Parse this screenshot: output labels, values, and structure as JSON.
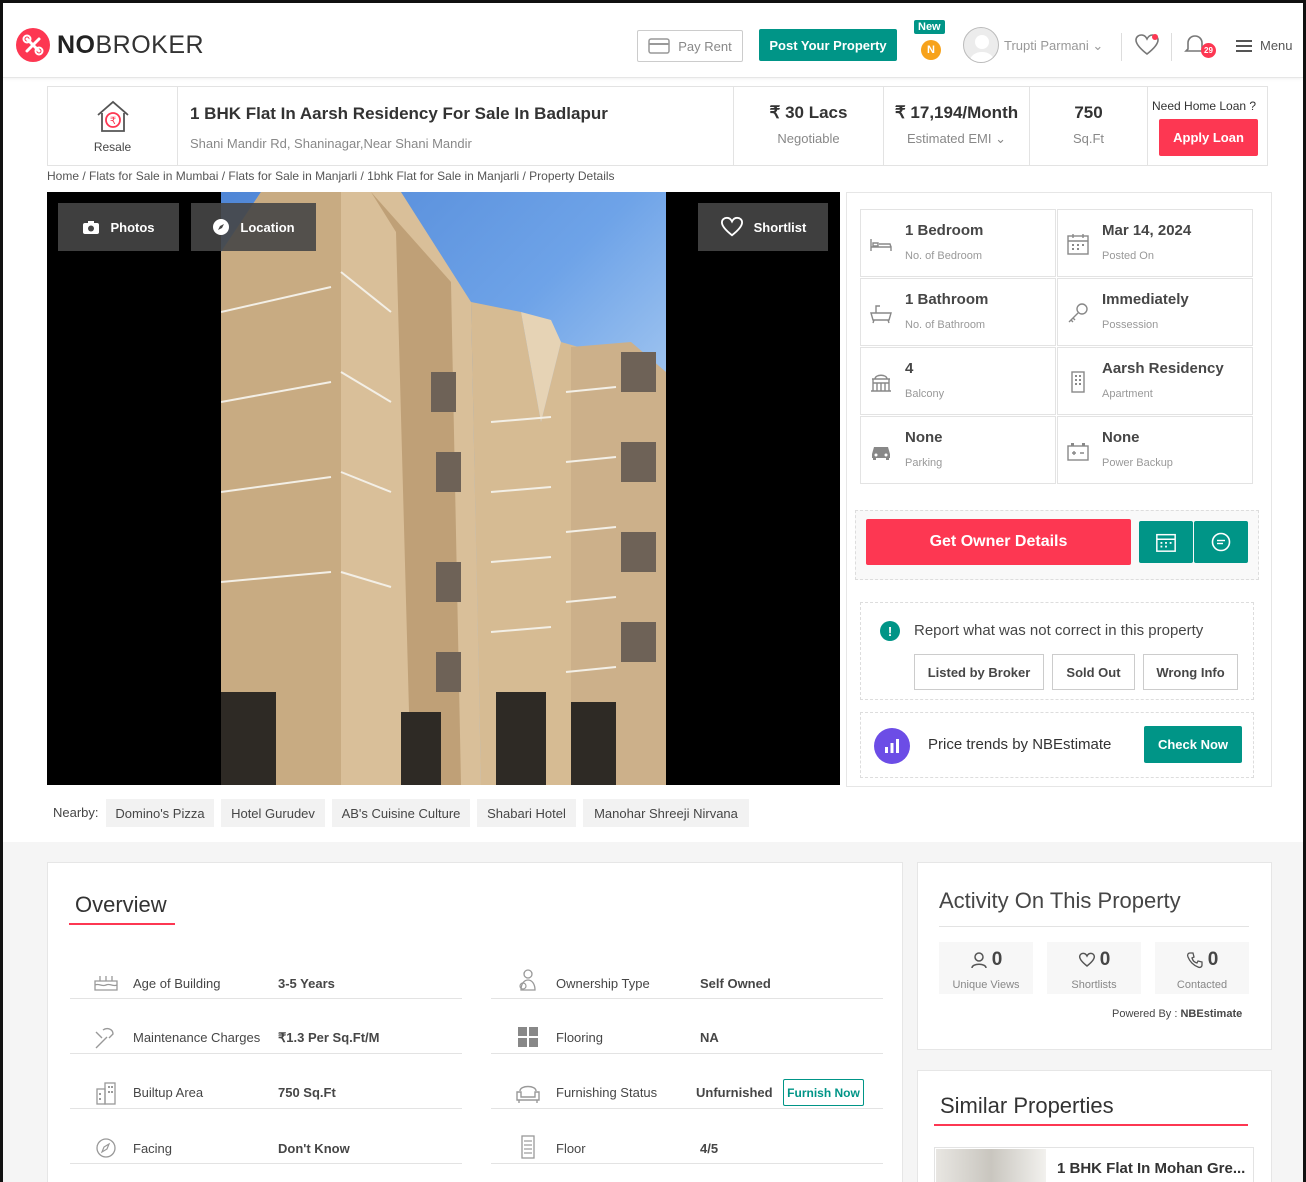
{
  "header": {
    "logo_bold": "NO",
    "logo_rest": "BROKER",
    "pay_rent": "Pay Rent",
    "post_property": "Post Your Property",
    "new_badge": "New",
    "coin_letter": "N",
    "user_name": "Trupti Parmani",
    "notification_count": "29",
    "menu": "Menu"
  },
  "listing": {
    "type_label": "Resale",
    "title": "1 BHK Flat In Aarsh Residency For Sale In Badlapur",
    "address": "Shani Mandir Rd, Shaninagar,Near Shani Mandir",
    "price": "₹ 30 Lacs",
    "price_note": "Negotiable",
    "emi": "₹ 17,194/Month",
    "emi_note": "Estimated EMI",
    "area": "750",
    "area_unit": "Sq.Ft",
    "loan_question": "Need Home Loan ?",
    "apply_loan": "Apply Loan"
  },
  "breadcrumb": "Home / Flats for Sale in Mumbai / Flats for Sale in Manjarli / 1bhk Flat for Sale in Manjarli / Property Details",
  "photo_buttons": {
    "photos": "Photos",
    "location": "Location",
    "shortlist": "Shortlist"
  },
  "specs": [
    {
      "value": "1 Bedroom",
      "label": "No. of Bedroom",
      "icon": "bed-icon"
    },
    {
      "value": "Mar 14, 2024",
      "label": "Posted On",
      "icon": "calendar-icon"
    },
    {
      "value": "1 Bathroom",
      "label": "No. of Bathroom",
      "icon": "bathtub-icon"
    },
    {
      "value": "Immediately",
      "label": "Possession",
      "icon": "key-icon"
    },
    {
      "value": "4",
      "label": "Balcony",
      "icon": "balcony-icon"
    },
    {
      "value": "Aarsh Residency",
      "label": "Apartment",
      "icon": "building-icon"
    },
    {
      "value": "None",
      "label": "Parking",
      "icon": "car-icon"
    },
    {
      "value": "None",
      "label": "Power Backup",
      "icon": "battery-icon"
    }
  ],
  "actions": {
    "get_owner": "Get Owner Details",
    "report_text": "Report what was not correct in this property",
    "report_buttons": [
      "Listed by Broker",
      "Sold Out",
      "Wrong Info"
    ],
    "trend_text": "Price trends by NBEstimate",
    "check_now": "Check Now"
  },
  "nearby": {
    "label": "Nearby:",
    "places": [
      "Domino's Pizza",
      "Hotel Gurudev",
      "AB's Cuisine Culture",
      "Shabari Hotel",
      "Manohar Shreeji Nirvana"
    ]
  },
  "overview": {
    "title": "Overview",
    "left": [
      {
        "label": "Age of Building",
        "value": "3-5 Years",
        "icon": "cake-icon"
      },
      {
        "label": "Maintenance Charges",
        "value": "₹1.3 Per Sq.Ft/M",
        "icon": "tools-icon"
      },
      {
        "label": "Builtup Area",
        "value": "750 Sq.Ft",
        "icon": "buildings-icon"
      },
      {
        "label": "Facing",
        "value": "Don't Know",
        "icon": "compass-icon"
      }
    ],
    "right": [
      {
        "label": "Ownership Type",
        "value": "Self Owned",
        "icon": "owner-icon"
      },
      {
        "label": "Flooring",
        "value": "NA",
        "icon": "tiles-icon"
      },
      {
        "label": "Furnishing Status",
        "value": "Unfurnished",
        "icon": "sofa-icon"
      },
      {
        "label": "Floor",
        "value": "4/5",
        "icon": "floor-icon"
      }
    ],
    "furnish_now": "Furnish Now"
  },
  "activity": {
    "title": "Activity On This Property",
    "stats": [
      {
        "value": "0",
        "label": "Unique Views"
      },
      {
        "value": "0",
        "label": "Shortlists"
      },
      {
        "value": "0",
        "label": "Contacted"
      }
    ],
    "powered_label": "Powered By :",
    "powered_by": "NBEstimate"
  },
  "similar": {
    "title": "Similar Properties",
    "first": "1 BHK Flat In Mohan Gre..."
  },
  "colors": {
    "brand_red": "#fd3752",
    "teal": "#009587",
    "purple": "#6c4de6"
  }
}
